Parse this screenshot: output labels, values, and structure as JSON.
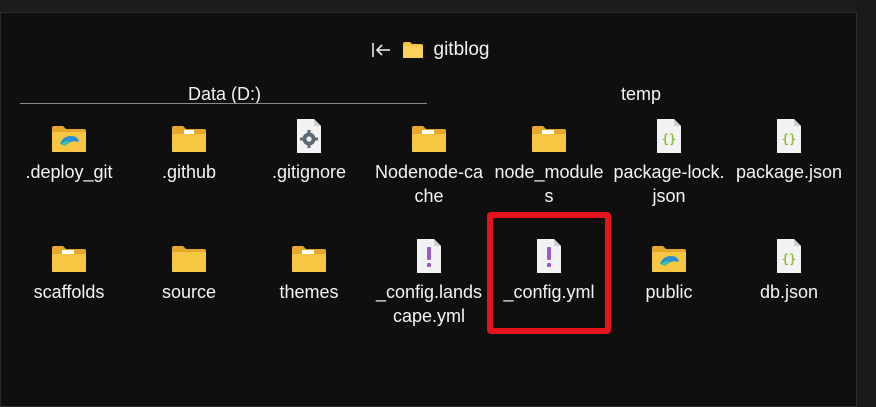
{
  "window": {
    "title": "gitblog",
    "back_icon": "collapse-left-icon"
  },
  "groups": {
    "drive_header": "Data (D:)",
    "temp_header": "temp"
  },
  "row1": [
    {
      "label": ".deploy_git",
      "icon": "folder-edge-icon"
    },
    {
      "label": ".github",
      "icon": "folder-doc-icon"
    },
    {
      "label": ".gitignore",
      "icon": "gear-file-icon"
    },
    {
      "label": "Nodenode-cache",
      "icon": "folder-doc-icon"
    },
    {
      "label": "node_modules",
      "icon": "folder-doc-icon"
    },
    {
      "label": "package-lock.json",
      "icon": "json-file-icon"
    },
    {
      "label": "package.json",
      "icon": "json-file-icon"
    }
  ],
  "row2": [
    {
      "label": "scaffolds",
      "icon": "folder-doc-icon"
    },
    {
      "label": "source",
      "icon": "folder-icon"
    },
    {
      "label": "themes",
      "icon": "folder-doc-icon"
    },
    {
      "label": "_config.landscape.yml",
      "icon": "yml-file-icon"
    },
    {
      "label": "_config.yml",
      "icon": "yml-file-icon"
    },
    {
      "label": "public",
      "icon": "folder-edge-icon"
    },
    {
      "label": "db.json",
      "icon": "json-file-icon"
    }
  ],
  "colors": {
    "folder": "#f5c242",
    "highlight": "#e3141b",
    "yml": "#9b59d0",
    "json": "#8bbf3a"
  }
}
